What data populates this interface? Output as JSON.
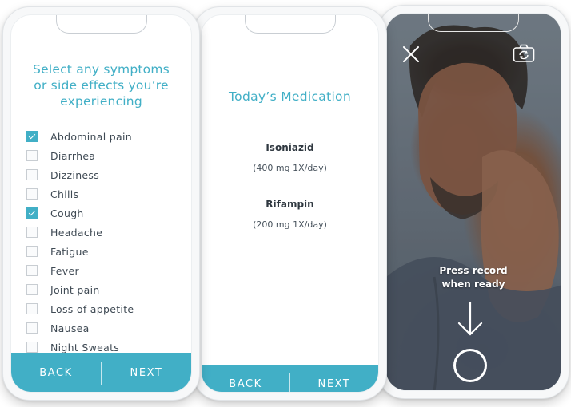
{
  "symptoms_screen": {
    "title_line1": "Select any symptoms",
    "title_line2": "or side effects you’re",
    "title_line3": "experiencing",
    "items": [
      {
        "label": "Abdominal pain",
        "checked": true
      },
      {
        "label": "Diarrhea",
        "checked": false
      },
      {
        "label": "Dizziness",
        "checked": false
      },
      {
        "label": "Chills",
        "checked": false
      },
      {
        "label": "Cough",
        "checked": true
      },
      {
        "label": "Headache",
        "checked": false
      },
      {
        "label": "Fatigue",
        "checked": false
      },
      {
        "label": "Fever",
        "checked": false
      },
      {
        "label": "Joint pain",
        "checked": false
      },
      {
        "label": "Loss of appetite",
        "checked": false
      },
      {
        "label": "Nausea",
        "checked": false
      },
      {
        "label": "Night Sweats",
        "checked": false
      }
    ],
    "back_label": "BACK",
    "next_label": "NEXT"
  },
  "medication_screen": {
    "title": "Today’s Medication",
    "medications": [
      {
        "name": "Isoniazid",
        "dose": "(400 mg 1X/day)"
      },
      {
        "name": "Rifampin",
        "dose": "(200 mg 1X/day)"
      }
    ],
    "back_label": "BACK",
    "next_label": "NEXT"
  },
  "camera_screen": {
    "instruction_line1": "Press record",
    "instruction_line2": "when ready",
    "icons": [
      "close-icon",
      "flip-camera-icon",
      "arrow-down-icon",
      "record-button"
    ]
  },
  "colors": {
    "accent": "#41afc6",
    "text_dark": "#3f4a54",
    "phone_frame": "#f7f8f9"
  }
}
